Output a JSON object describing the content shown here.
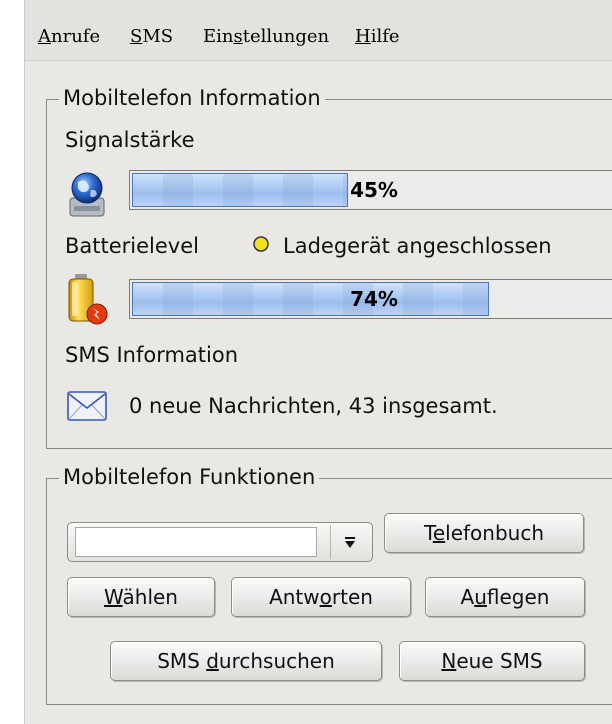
{
  "menubar": {
    "items": [
      {
        "label_acc": "A",
        "label_rest": "nrufe"
      },
      {
        "label_acc": "S",
        "label_rest": "MS"
      },
      {
        "label_pre": "Ein",
        "label_acc": "s",
        "label_rest": "tellungen"
      },
      {
        "label_acc": "H",
        "label_rest": "ilfe"
      }
    ]
  },
  "info_group": {
    "title": "Mobiltelefon Information",
    "signal_label": "Signalstärke",
    "signal": {
      "percent": 45,
      "text": "45%",
      "icon": "network-globe-icon"
    },
    "battery_label": "Batterielevel",
    "charger_status": "Ladegerät angeschlossen",
    "charger_led_color": "#f2e21c",
    "battery": {
      "percent": 74,
      "text": "74%",
      "icon": "battery-charging-icon"
    },
    "sms_label": "SMS Information",
    "sms_status": "0 neue Nachrichten, 43 insgesamt.",
    "sms_icon": "envelope-icon"
  },
  "functions_group": {
    "title": "Mobiltelefon Funktionen",
    "combo_value": "",
    "buttons": {
      "phonebook": {
        "pre": "T",
        "acc": "e",
        "post": "lefonbuch"
      },
      "dial": {
        "pre": "",
        "acc": "W",
        "post": "ählen"
      },
      "answer": {
        "pre": "Antw",
        "acc": "o",
        "post": "rten"
      },
      "hangup": {
        "pre": "A",
        "acc": "u",
        "post": "flegen"
      },
      "search_sms": {
        "pre": "SMS ",
        "acc": "d",
        "post": "urchsuchen"
      },
      "new_sms": {
        "pre": "",
        "acc": "N",
        "post": "eue SMS"
      }
    }
  },
  "colors": {
    "window_bg": "#eae8e5",
    "progress_fill": "#a9c8f2"
  }
}
